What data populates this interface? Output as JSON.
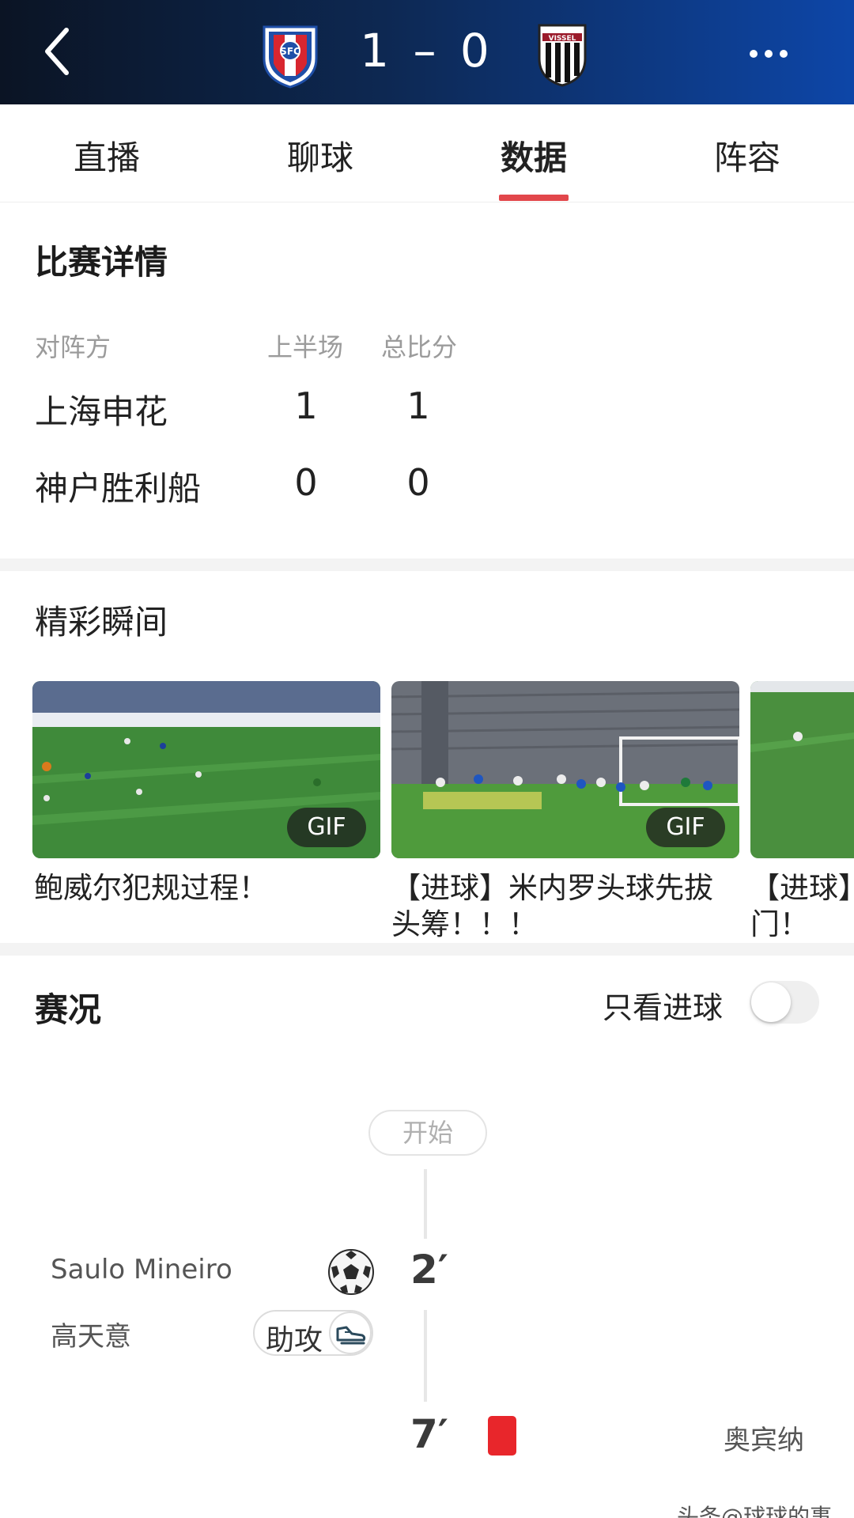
{
  "header": {
    "score": "1 – 0",
    "home_crest_icon": "shenhua-crest-icon",
    "away_crest_icon": "vissel-crest-icon",
    "back_icon": "chevron-left-icon",
    "more_icon": "more-dots-icon",
    "colors": {
      "gradient_start": "#0b1424",
      "gradient_end": "#0d46a8"
    }
  },
  "tabs": [
    {
      "label": "直播"
    },
    {
      "label": "聊球"
    },
    {
      "label": "数据",
      "active": true
    },
    {
      "label": "阵容"
    }
  ],
  "accent_color": "#e2474b",
  "match_detail": {
    "title": "比赛详情",
    "columns": [
      "对阵方",
      "上半场",
      "总比分"
    ],
    "rows": [
      {
        "team": "上海申花",
        "first_half": "1",
        "total": "1"
      },
      {
        "team": "神户胜利船",
        "first_half": "0",
        "total": "0"
      }
    ]
  },
  "highlights": {
    "title": "精彩瞬间",
    "items": [
      {
        "badge": "GIF",
        "caption_line1": "鲍威尔犯规过程！",
        "caption_line2": ""
      },
      {
        "badge": "GIF",
        "caption_line1": "【进球】米内罗头球先拔",
        "caption_line2": "头筹！！！"
      },
      {
        "badge": "",
        "caption_line1": "【进球】",
        "caption_line2": "门！"
      }
    ]
  },
  "live": {
    "title": "赛况",
    "goals_only_label": "只看进球",
    "goals_only_on": false,
    "start_label": "开始",
    "events": [
      {
        "minute": "2′",
        "player": "Saulo Mineiro",
        "icon": "football-icon",
        "assist_player": "高天意",
        "assist_label": "助攻",
        "assist_icon": "boot-icon"
      },
      {
        "minute": "7′",
        "player": "奥宾纳",
        "icon": "red-card-icon"
      }
    ]
  },
  "watermark": "头条@球球的事"
}
